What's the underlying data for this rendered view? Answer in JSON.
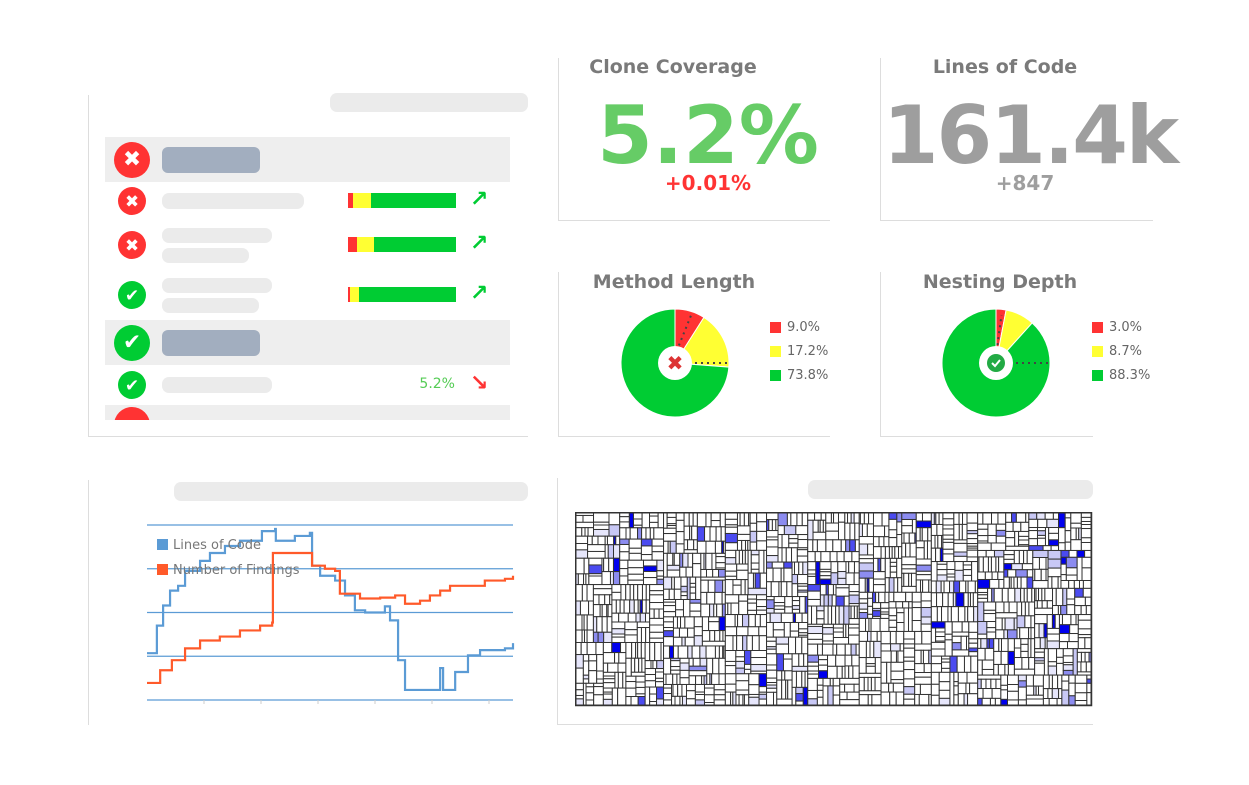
{
  "colors": {
    "red": "#ff3333",
    "yellow": "#ffff33",
    "green": "#00cc33",
    "blue": "#5b9bd5",
    "orange": "#ff5a2a",
    "gray": "#9e9e9e"
  },
  "findings_table": {
    "rows": [
      {
        "type": "group",
        "status": "fail"
      },
      {
        "type": "item",
        "status": "fail",
        "lines": 1,
        "distribution": {
          "red": 5,
          "yellow": 16,
          "green": 79
        },
        "trend": "up-right-arrow",
        "trend_color": "#00cc33"
      },
      {
        "type": "item",
        "status": "fail",
        "lines": 2,
        "distribution": {
          "red": 8,
          "yellow": 16,
          "green": 76
        },
        "trend": "up-right-arrow",
        "trend_color": "#00cc33"
      },
      {
        "type": "item",
        "status": "pass",
        "lines": 2,
        "distribution": {
          "red": 2,
          "yellow": 8,
          "green": 90
        },
        "trend": "up-right-arrow",
        "trend_color": "#00cc33"
      },
      {
        "type": "group",
        "status": "pass"
      },
      {
        "type": "item",
        "status": "pass",
        "lines": 1,
        "value": "5.2%",
        "trend": "down-right-arrow",
        "trend_color": "#ff3333"
      }
    ]
  },
  "clone_coverage": {
    "title": "Clone Coverage",
    "value": "5.2%",
    "delta": "+0.01%"
  },
  "lines_of_code": {
    "title": "Lines of Code",
    "value": "161.4k",
    "delta": "+847"
  },
  "method_length": {
    "title": "Method Length",
    "status": "fail",
    "slices": [
      {
        "label": "9.0%",
        "value": 9.0,
        "color": "#ff3333"
      },
      {
        "label": "17.2%",
        "value": 17.2,
        "color": "#ffff33"
      },
      {
        "label": "73.8%",
        "value": 73.8,
        "color": "#00cc33"
      }
    ]
  },
  "nesting_depth": {
    "title": "Nesting Depth",
    "status": "pass",
    "slices": [
      {
        "label": "3.0%",
        "value": 3.0,
        "color": "#ff3333"
      },
      {
        "label": "8.7%",
        "value": 8.7,
        "color": "#ffff33"
      },
      {
        "label": "88.3%",
        "value": 88.3,
        "color": "#00cc33"
      }
    ]
  },
  "chart_data": {
    "type": "line",
    "step": true,
    "grid": true,
    "legend_placement": "top-left",
    "ylim": [
      0,
      4
    ],
    "xlim": [
      0,
      100
    ],
    "series": [
      {
        "name": "Lines of Code",
        "color": "#5b9bd5",
        "points": [
          [
            0,
            1.07
          ],
          [
            2.7,
            1.7
          ],
          [
            4.4,
            2.16
          ],
          [
            6.3,
            2.5
          ],
          [
            8.5,
            2.61
          ],
          [
            10.4,
            2.95
          ],
          [
            14.5,
            3.18
          ],
          [
            17.2,
            3.36
          ],
          [
            21.3,
            3.52
          ],
          [
            25.4,
            3.64
          ],
          [
            31.4,
            3.86
          ],
          [
            35.0,
            3.91
          ],
          [
            35.2,
            3.64
          ],
          [
            40.4,
            3.75
          ],
          [
            44.5,
            3.82
          ],
          [
            45.1,
            3.07
          ],
          [
            47.3,
            2.84
          ],
          [
            51.4,
            2.73
          ],
          [
            54.1,
            2.39
          ],
          [
            56.8,
            2.05
          ],
          [
            59.6,
            2.0
          ],
          [
            65.0,
            2.14
          ],
          [
            66.4,
            1.82
          ],
          [
            68.6,
            0.91
          ],
          [
            70.5,
            0.23
          ],
          [
            77.3,
            0.23
          ],
          [
            80.1,
            0.73
          ],
          [
            80.9,
            0.23
          ],
          [
            84.2,
            0.64
          ],
          [
            87.7,
            1.02
          ],
          [
            91.0,
            1.14
          ],
          [
            97.8,
            1.18
          ],
          [
            100,
            1.3
          ]
        ]
      },
      {
        "name": "Number of Findings",
        "color": "#ff5a2a",
        "points": [
          [
            0,
            0.39
          ],
          [
            2.2,
            0.39
          ],
          [
            3.6,
            0.68
          ],
          [
            6.8,
            0.91
          ],
          [
            10.4,
            1.18
          ],
          [
            14.5,
            1.36
          ],
          [
            19.9,
            1.45
          ],
          [
            25.4,
            1.59
          ],
          [
            30.9,
            1.7
          ],
          [
            34.2,
            1.77
          ],
          [
            34.4,
            3.36
          ],
          [
            43.2,
            3.36
          ],
          [
            45.1,
            3.07
          ],
          [
            48.6,
            3.0
          ],
          [
            51.4,
            2.95
          ],
          [
            52.7,
            2.43
          ],
          [
            58.2,
            2.32
          ],
          [
            63.7,
            2.34
          ],
          [
            67.8,
            2.39
          ],
          [
            70.5,
            2.2
          ],
          [
            74.6,
            2.27
          ],
          [
            77.3,
            2.39
          ],
          [
            80.1,
            2.5
          ],
          [
            82.8,
            2.61
          ],
          [
            88.3,
            2.61
          ],
          [
            92.3,
            2.73
          ],
          [
            97.8,
            2.77
          ],
          [
            100,
            2.84
          ]
        ]
      }
    ]
  },
  "treemap": {
    "fill_colors": [
      "#ffffff",
      "#e6e6fb",
      "#c8c8f5",
      "#8c8cf0",
      "#4b4bf0",
      "#0000ee"
    ]
  }
}
